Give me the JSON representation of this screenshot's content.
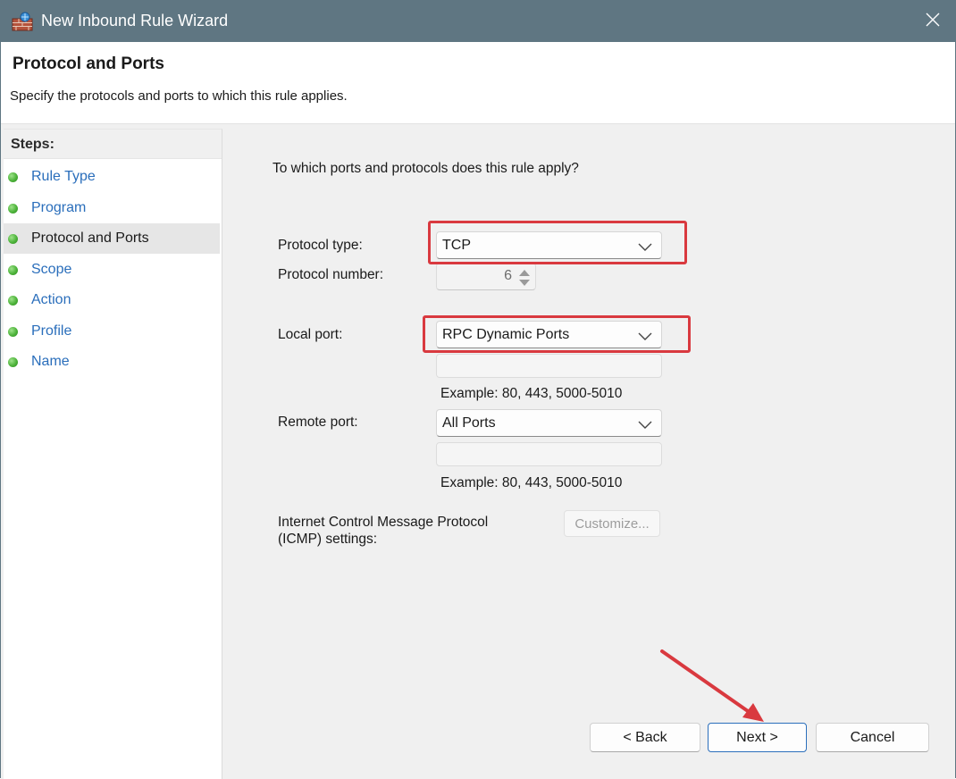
{
  "window": {
    "title": "New Inbound Rule Wizard",
    "title_icon": "firewall-icon",
    "close_icon": "close-icon"
  },
  "header": {
    "title": "Protocol and Ports",
    "subtitle": "Specify the protocols and ports to which this rule applies."
  },
  "steps": {
    "title": "Steps:",
    "items": [
      {
        "label": "Rule Type",
        "active": false
      },
      {
        "label": "Program",
        "active": false
      },
      {
        "label": "Protocol and Ports",
        "active": true
      },
      {
        "label": "Scope",
        "active": false
      },
      {
        "label": "Action",
        "active": false
      },
      {
        "label": "Profile",
        "active": false
      },
      {
        "label": "Name",
        "active": false
      }
    ]
  },
  "main": {
    "question": "To which ports and protocols does this rule apply?",
    "protocol_type": {
      "label": "Protocol type:",
      "value": "TCP"
    },
    "protocol_number": {
      "label": "Protocol number:",
      "value": "6"
    },
    "local_port": {
      "label": "Local port:",
      "value": "RPC Dynamic Ports",
      "input_value": "",
      "example": "Example: 80, 443, 5000-5010"
    },
    "remote_port": {
      "label": "Remote port:",
      "value": "All Ports",
      "input_value": "",
      "example": "Example: 80, 443, 5000-5010"
    },
    "icmp": {
      "label_line1": "Internet Control Message Protocol",
      "label_line2": "(ICMP) settings:",
      "button": "Customize..."
    }
  },
  "buttons": {
    "back": "< Back",
    "next": "Next >",
    "cancel": "Cancel"
  },
  "annotations": {
    "highlight_color": "#d9393f",
    "arrow_color": "#d9393f"
  }
}
